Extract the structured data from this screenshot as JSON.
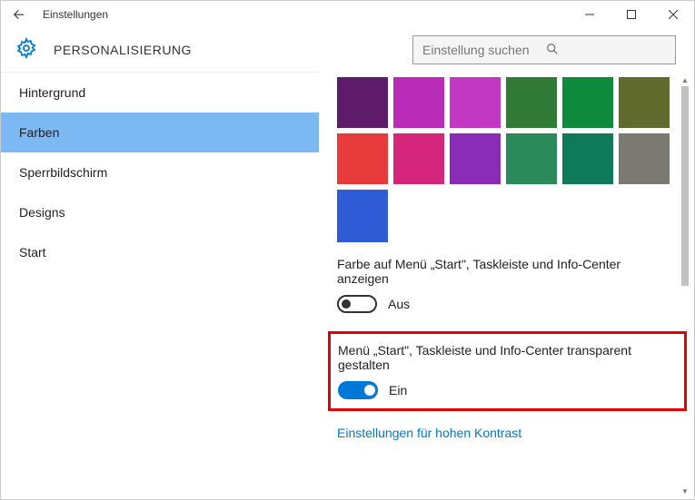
{
  "window": {
    "title": "Einstellungen"
  },
  "header": {
    "title": "PERSONALISIERUNG",
    "search_placeholder": "Einstellung suchen"
  },
  "sidebar": {
    "items": [
      {
        "label": "Hintergrund"
      },
      {
        "label": "Farben"
      },
      {
        "label": "Sperrbildschirm"
      },
      {
        "label": "Designs"
      },
      {
        "label": "Start"
      }
    ]
  },
  "main": {
    "swatch_rows": [
      [
        "#5e1b6a",
        "#b82cb8",
        "#c238c2",
        "#317a37",
        "#0f8a3d",
        "#5f6a2c"
      ],
      [
        "#e83c3c",
        "#d4267a",
        "#8a2cb8",
        "#2a8a5a",
        "#0f7a5a",
        "#7a7a72"
      ]
    ],
    "swatch_last": "#2f5cd6",
    "setting1_label": "Farbe auf Menü „Start\", Taskleiste und Info-Center anzeigen",
    "setting1_state": "Aus",
    "setting2_label": "Menü „Start\", Taskleiste und Info-Center transparent gestalten",
    "setting2_state": "Ein",
    "contrast_link": "Einstellungen für hohen Kontrast"
  }
}
